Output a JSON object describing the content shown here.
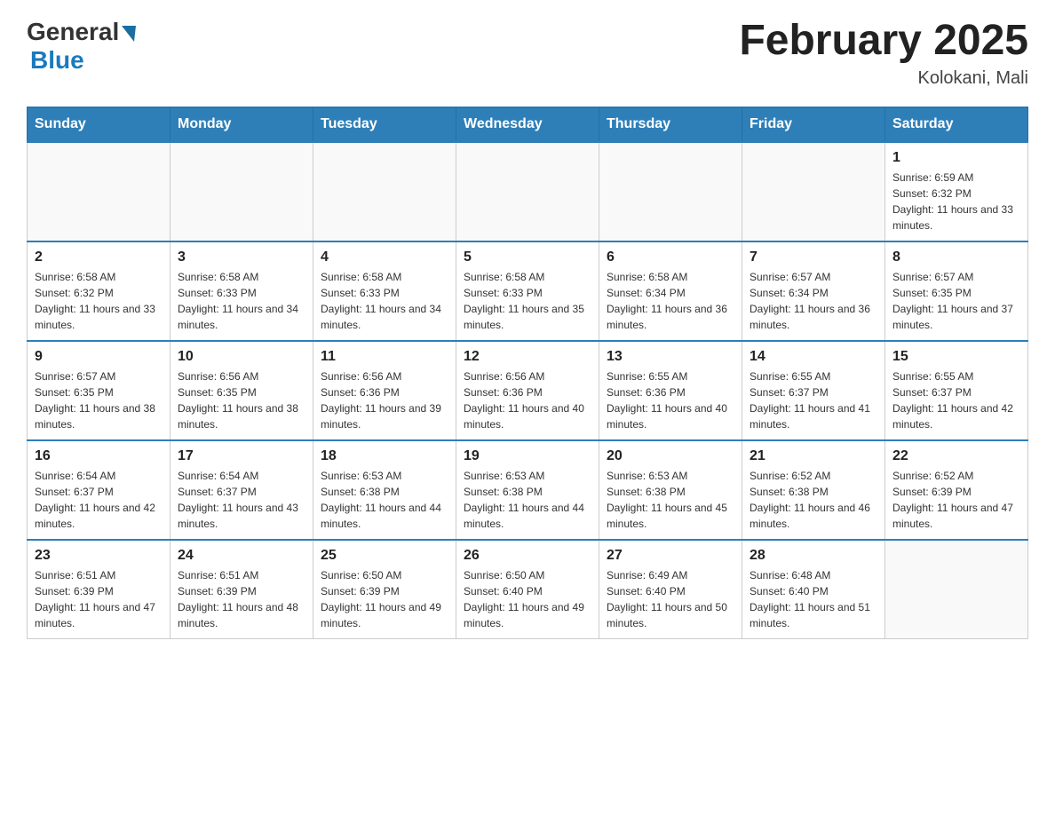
{
  "header": {
    "logo_general": "General",
    "logo_blue": "Blue",
    "title": "February 2025",
    "subtitle": "Kolokani, Mali"
  },
  "days_of_week": [
    "Sunday",
    "Monday",
    "Tuesday",
    "Wednesday",
    "Thursday",
    "Friday",
    "Saturday"
  ],
  "weeks": [
    [
      {
        "day": "",
        "info": ""
      },
      {
        "day": "",
        "info": ""
      },
      {
        "day": "",
        "info": ""
      },
      {
        "day": "",
        "info": ""
      },
      {
        "day": "",
        "info": ""
      },
      {
        "day": "",
        "info": ""
      },
      {
        "day": "1",
        "info": "Sunrise: 6:59 AM\nSunset: 6:32 PM\nDaylight: 11 hours and 33 minutes."
      }
    ],
    [
      {
        "day": "2",
        "info": "Sunrise: 6:58 AM\nSunset: 6:32 PM\nDaylight: 11 hours and 33 minutes."
      },
      {
        "day": "3",
        "info": "Sunrise: 6:58 AM\nSunset: 6:33 PM\nDaylight: 11 hours and 34 minutes."
      },
      {
        "day": "4",
        "info": "Sunrise: 6:58 AM\nSunset: 6:33 PM\nDaylight: 11 hours and 34 minutes."
      },
      {
        "day": "5",
        "info": "Sunrise: 6:58 AM\nSunset: 6:33 PM\nDaylight: 11 hours and 35 minutes."
      },
      {
        "day": "6",
        "info": "Sunrise: 6:58 AM\nSunset: 6:34 PM\nDaylight: 11 hours and 36 minutes."
      },
      {
        "day": "7",
        "info": "Sunrise: 6:57 AM\nSunset: 6:34 PM\nDaylight: 11 hours and 36 minutes."
      },
      {
        "day": "8",
        "info": "Sunrise: 6:57 AM\nSunset: 6:35 PM\nDaylight: 11 hours and 37 minutes."
      }
    ],
    [
      {
        "day": "9",
        "info": "Sunrise: 6:57 AM\nSunset: 6:35 PM\nDaylight: 11 hours and 38 minutes."
      },
      {
        "day": "10",
        "info": "Sunrise: 6:56 AM\nSunset: 6:35 PM\nDaylight: 11 hours and 38 minutes."
      },
      {
        "day": "11",
        "info": "Sunrise: 6:56 AM\nSunset: 6:36 PM\nDaylight: 11 hours and 39 minutes."
      },
      {
        "day": "12",
        "info": "Sunrise: 6:56 AM\nSunset: 6:36 PM\nDaylight: 11 hours and 40 minutes."
      },
      {
        "day": "13",
        "info": "Sunrise: 6:55 AM\nSunset: 6:36 PM\nDaylight: 11 hours and 40 minutes."
      },
      {
        "day": "14",
        "info": "Sunrise: 6:55 AM\nSunset: 6:37 PM\nDaylight: 11 hours and 41 minutes."
      },
      {
        "day": "15",
        "info": "Sunrise: 6:55 AM\nSunset: 6:37 PM\nDaylight: 11 hours and 42 minutes."
      }
    ],
    [
      {
        "day": "16",
        "info": "Sunrise: 6:54 AM\nSunset: 6:37 PM\nDaylight: 11 hours and 42 minutes."
      },
      {
        "day": "17",
        "info": "Sunrise: 6:54 AM\nSunset: 6:37 PM\nDaylight: 11 hours and 43 minutes."
      },
      {
        "day": "18",
        "info": "Sunrise: 6:53 AM\nSunset: 6:38 PM\nDaylight: 11 hours and 44 minutes."
      },
      {
        "day": "19",
        "info": "Sunrise: 6:53 AM\nSunset: 6:38 PM\nDaylight: 11 hours and 44 minutes."
      },
      {
        "day": "20",
        "info": "Sunrise: 6:53 AM\nSunset: 6:38 PM\nDaylight: 11 hours and 45 minutes."
      },
      {
        "day": "21",
        "info": "Sunrise: 6:52 AM\nSunset: 6:38 PM\nDaylight: 11 hours and 46 minutes."
      },
      {
        "day": "22",
        "info": "Sunrise: 6:52 AM\nSunset: 6:39 PM\nDaylight: 11 hours and 47 minutes."
      }
    ],
    [
      {
        "day": "23",
        "info": "Sunrise: 6:51 AM\nSunset: 6:39 PM\nDaylight: 11 hours and 47 minutes."
      },
      {
        "day": "24",
        "info": "Sunrise: 6:51 AM\nSunset: 6:39 PM\nDaylight: 11 hours and 48 minutes."
      },
      {
        "day": "25",
        "info": "Sunrise: 6:50 AM\nSunset: 6:39 PM\nDaylight: 11 hours and 49 minutes."
      },
      {
        "day": "26",
        "info": "Sunrise: 6:50 AM\nSunset: 6:40 PM\nDaylight: 11 hours and 49 minutes."
      },
      {
        "day": "27",
        "info": "Sunrise: 6:49 AM\nSunset: 6:40 PM\nDaylight: 11 hours and 50 minutes."
      },
      {
        "day": "28",
        "info": "Sunrise: 6:48 AM\nSunset: 6:40 PM\nDaylight: 11 hours and 51 minutes."
      },
      {
        "day": "",
        "info": ""
      }
    ]
  ]
}
